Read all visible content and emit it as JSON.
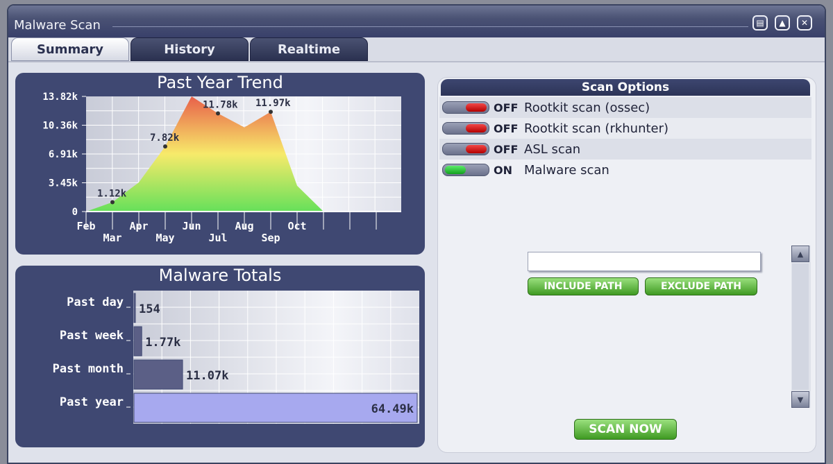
{
  "window": {
    "title": "Malware Scan",
    "buttons": [
      "restore-icon",
      "pin-icon",
      "close-icon"
    ]
  },
  "tabs": [
    {
      "label": "Summary",
      "active": true
    },
    {
      "label": "History",
      "active": false
    },
    {
      "label": "Realtime",
      "active": false
    }
  ],
  "trend": {
    "title": "Past Year Trend",
    "chart_data": {
      "type": "area",
      "title": "Past Year Trend",
      "categories": [
        "Feb",
        "Mar",
        "Apr",
        "May",
        "Jun",
        "Jul",
        "Aug",
        "Sep",
        "Oct"
      ],
      "y_tick_labels": [
        "13.82k",
        "10.36k",
        "6.91k",
        "3.45k",
        "0"
      ],
      "y_ticks": [
        13820,
        10360,
        6910,
        3450,
        0
      ],
      "ylim": [
        0,
        13820
      ],
      "values": [
        0,
        1120,
        3500,
        7820,
        13820,
        11780,
        10100,
        11970,
        3100,
        0
      ],
      "x_positions": [
        0,
        1,
        2,
        3,
        4,
        5,
        6,
        7,
        8,
        9
      ],
      "data_labels": [
        {
          "index": 1,
          "text": "1.12k"
        },
        {
          "index": 3,
          "text": "7.82k"
        },
        {
          "index": 5,
          "text": "11.78k"
        },
        {
          "index": 7,
          "text": "11.97k"
        }
      ],
      "grid": true,
      "colors": {
        "low": "#66e05a",
        "mid": "#f7ea6a",
        "high": "#e8604a"
      }
    }
  },
  "totals": {
    "title": "Malware Totals",
    "chart_data": {
      "type": "bar",
      "orientation": "horizontal",
      "title": "Malware Totals",
      "categories": [
        "Past day",
        "Past week",
        "Past month",
        "Past year"
      ],
      "values": [
        154,
        1770,
        11070,
        64490
      ],
      "value_labels": [
        "154",
        "1.77k",
        "11.07k",
        "64.49k"
      ],
      "xlim": [
        0,
        64490
      ],
      "grid": true,
      "colors": [
        "#5b5f86",
        "#5b5f86",
        "#5b5f86",
        "#a7a9ef"
      ]
    }
  },
  "scan_options": {
    "title": "Scan Options",
    "items": [
      {
        "state": "OFF",
        "on": false,
        "label": "Rootkit scan (ossec)"
      },
      {
        "state": "OFF",
        "on": false,
        "label": "Rootkit scan (rkhunter)"
      },
      {
        "state": "OFF",
        "on": false,
        "label": "ASL scan"
      },
      {
        "state": "ON",
        "on": true,
        "label": "Malware scan"
      }
    ],
    "path_value": "",
    "include_label": "INCLUDE PATH",
    "exclude_label": "EXCLUDE PATH",
    "scan_label": "SCAN NOW"
  }
}
